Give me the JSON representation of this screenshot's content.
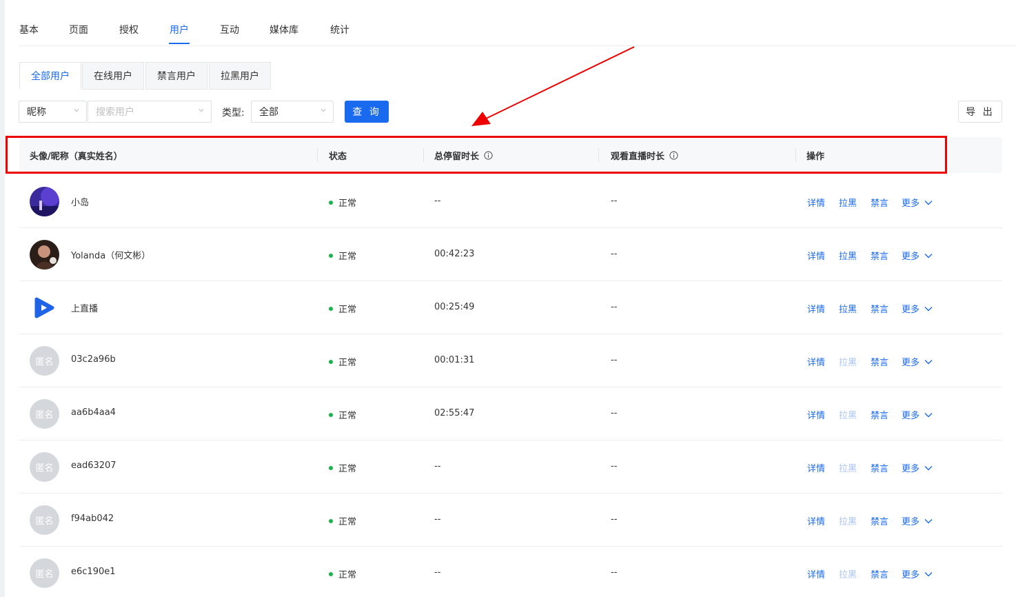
{
  "nav": {
    "items": [
      "基本",
      "页面",
      "授权",
      "用户",
      "互动",
      "媒体库",
      "统计"
    ],
    "active_index": 3
  },
  "sub_tabs": {
    "items": [
      "全部用户",
      "在线用户",
      "禁言用户",
      "拉黑用户"
    ],
    "active_index": 0
  },
  "filters": {
    "field_select_value": "昵称",
    "search_placeholder": "搜索用户",
    "type_label": "类型:",
    "type_select_value": "全部",
    "query_button": "查 询",
    "export_button": "导 出"
  },
  "table": {
    "columns": {
      "avatar_name": "头像/昵称（真实姓名）",
      "status": "状态",
      "dwell": "总停留时长",
      "watch": "观看直播时长",
      "actions": "操作"
    },
    "action_labels": {
      "detail": "详情",
      "block": "拉黑",
      "mute": "禁言",
      "more": "更多"
    },
    "anonymous_label": "匿名",
    "rows": [
      {
        "avatar": "photo-purple",
        "name": "小岛",
        "status": "正常",
        "dwell": "--",
        "watch": "--",
        "block_enabled": true
      },
      {
        "avatar": "photo-portrait",
        "name": "Yolanda（何文彬）",
        "status": "正常",
        "dwell": "00:42:23",
        "watch": "--",
        "block_enabled": true
      },
      {
        "avatar": "logo-play",
        "name": "上直播",
        "status": "正常",
        "dwell": "00:25:49",
        "watch": "--",
        "block_enabled": true
      },
      {
        "avatar": "anonymous",
        "name": "03c2a96b",
        "status": "正常",
        "dwell": "00:01:31",
        "watch": "--",
        "block_enabled": false
      },
      {
        "avatar": "anonymous",
        "name": "aa6b4aa4",
        "status": "正常",
        "dwell": "02:55:47",
        "watch": "--",
        "block_enabled": false
      },
      {
        "avatar": "anonymous",
        "name": "ead63207",
        "status": "正常",
        "dwell": "--",
        "watch": "--",
        "block_enabled": false
      },
      {
        "avatar": "anonymous",
        "name": "f94ab042",
        "status": "正常",
        "dwell": "--",
        "watch": "--",
        "block_enabled": false
      },
      {
        "avatar": "anonymous",
        "name": "e6c190e1",
        "status": "正常",
        "dwell": "--",
        "watch": "--",
        "block_enabled": false
      }
    ]
  },
  "colors": {
    "accent": "#1a6af0",
    "status_ok": "#19b34c",
    "highlight": "#ee0000"
  }
}
